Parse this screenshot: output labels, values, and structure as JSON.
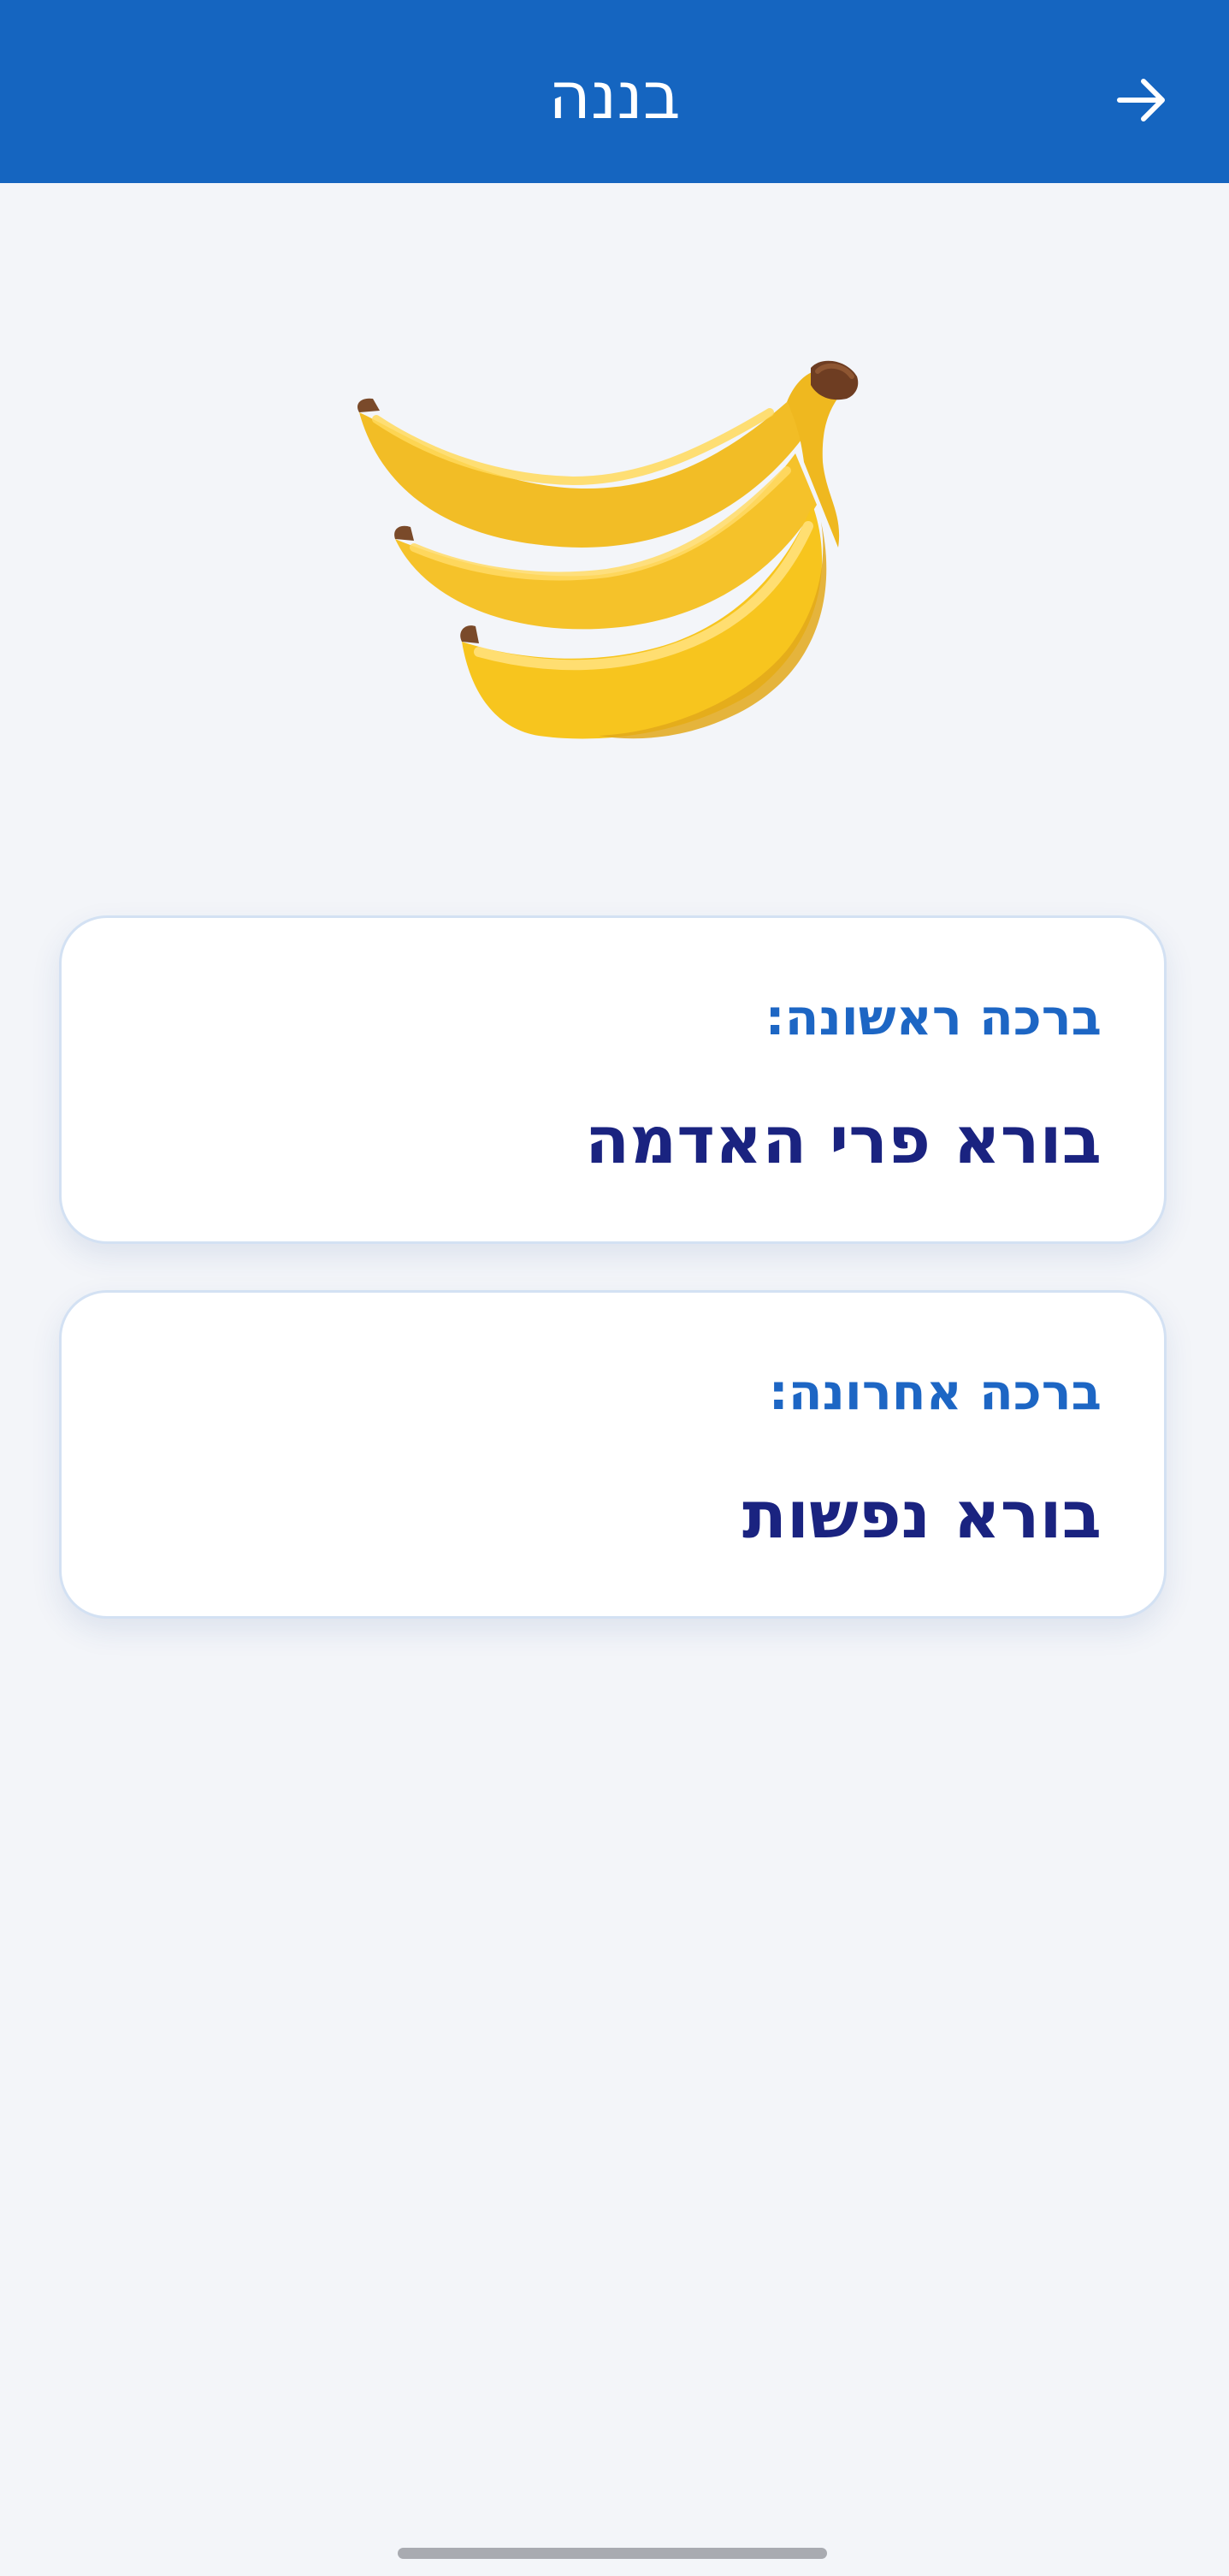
{
  "header": {
    "title": "בננה",
    "back_icon": "arrow-right-icon",
    "background_color": "#1565c0"
  },
  "image": {
    "icon": "banana-icon"
  },
  "first_blessing": {
    "label": "ברכה ראשונה:",
    "value": "בורא פרי האדמה"
  },
  "last_blessing": {
    "label": "ברכה אחרונה:",
    "value": "בורא נפשות"
  },
  "colors": {
    "accent": "#1565c0",
    "label": "#1d66c4",
    "value": "#1a2380",
    "background": "#f3f5f9"
  }
}
